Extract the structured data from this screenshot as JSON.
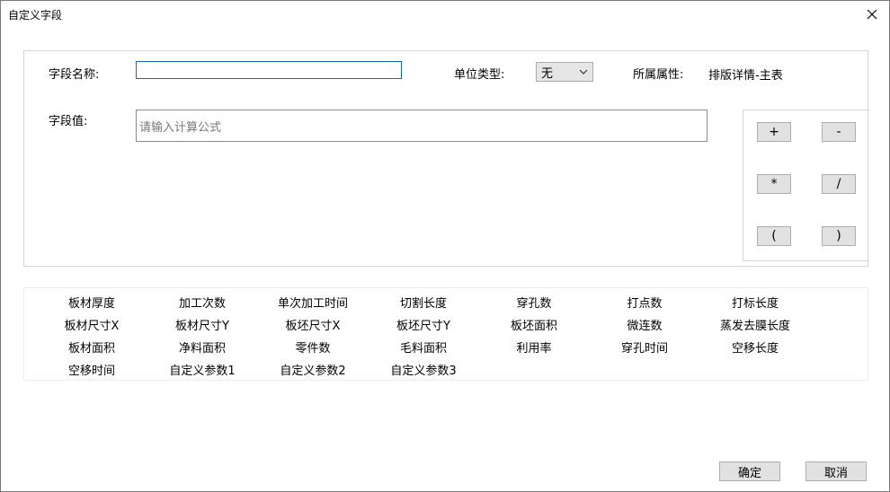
{
  "window": {
    "title": "自定义字段"
  },
  "form": {
    "field_name_label": "字段名称:",
    "field_name_value": "",
    "unit_type_label": "单位类型:",
    "unit_type_value": "无",
    "attribute_label": "所属属性:",
    "attribute_value": "排版详情-主表",
    "field_value_label": "字段值:",
    "formula_placeholder": "请输入计算公式"
  },
  "operators": [
    "+",
    "-",
    "*",
    "/",
    "(",
    ")"
  ],
  "fields": [
    [
      "板材厚度",
      "加工次数",
      "单次加工时间",
      "切割长度",
      "穿孔数",
      "打点数",
      "打标长度"
    ],
    [
      "板材尺寸X",
      "板材尺寸Y",
      "板坯尺寸X",
      "板坯尺寸Y",
      "板坯面积",
      "微连数",
      "蒸发去膜长度"
    ],
    [
      "板材面积",
      "净料面积",
      "零件数",
      "毛料面积",
      "利用率",
      "穿孔时间",
      "空移长度"
    ],
    [
      "空移时间",
      "自定义参数1",
      "自定义参数2",
      "自定义参数3"
    ]
  ],
  "buttons": {
    "ok": "确定",
    "cancel": "取消"
  }
}
